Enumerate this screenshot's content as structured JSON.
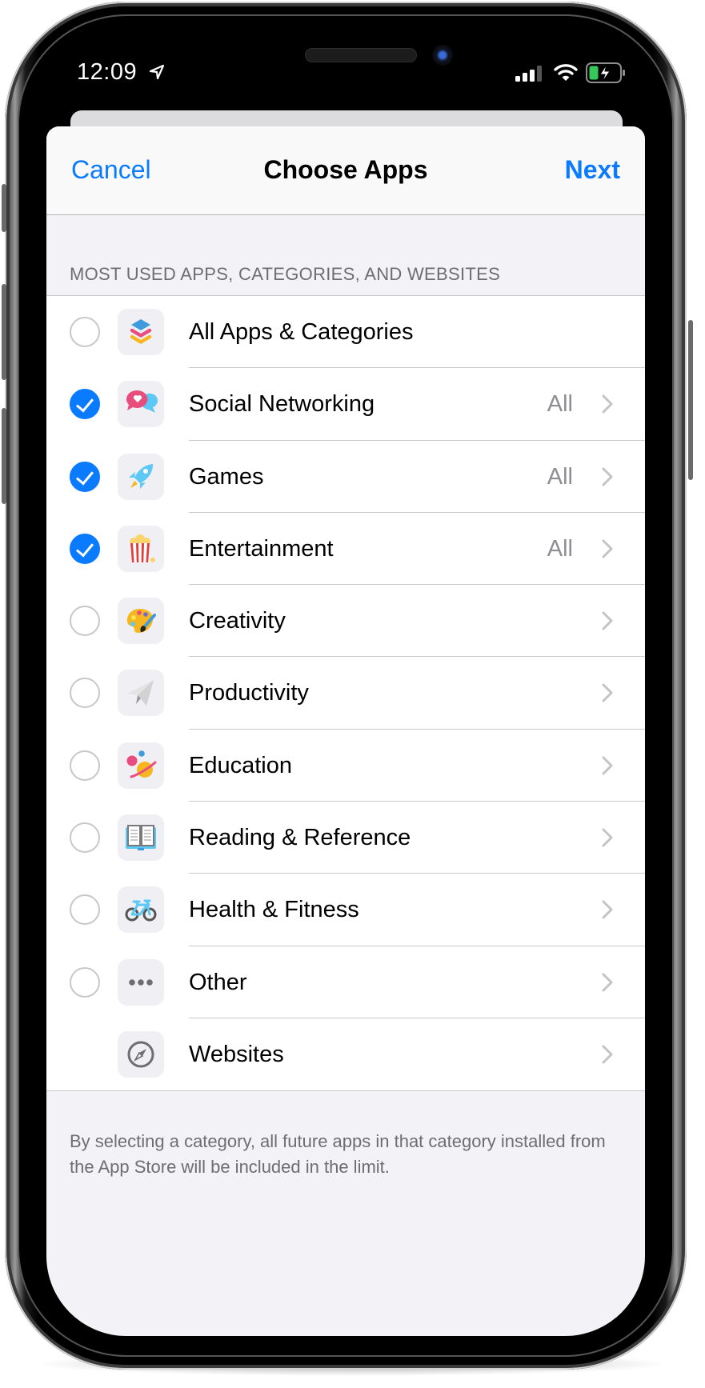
{
  "status_bar": {
    "time": "12:09",
    "icons": [
      "location-arrow-icon",
      "cellular-signal-icon",
      "wifi-icon",
      "battery-charging-icon"
    ]
  },
  "navbar": {
    "cancel_label": "Cancel",
    "title": "Choose Apps",
    "next_label": "Next"
  },
  "section_header": "MOST USED APPS, CATEGORIES, AND WEBSITES",
  "items": [
    {
      "label": "All Apps & Categories",
      "icon": "stack-layers-icon",
      "checked": false,
      "has_radio": true,
      "detail": "",
      "chevron": false
    },
    {
      "label": "Social Networking",
      "icon": "chat-bubbles-heart-icon",
      "checked": true,
      "has_radio": true,
      "detail": "All",
      "chevron": true
    },
    {
      "label": "Games",
      "icon": "rocket-icon",
      "checked": true,
      "has_radio": true,
      "detail": "All",
      "chevron": true
    },
    {
      "label": "Entertainment",
      "icon": "popcorn-icon",
      "checked": true,
      "has_radio": true,
      "detail": "All",
      "chevron": true
    },
    {
      "label": "Creativity",
      "icon": "paint-palette-icon",
      "checked": false,
      "has_radio": true,
      "detail": "",
      "chevron": true
    },
    {
      "label": "Productivity",
      "icon": "paper-plane-icon",
      "checked": false,
      "has_radio": true,
      "detail": "",
      "chevron": true
    },
    {
      "label": "Education",
      "icon": "planet-icon",
      "checked": false,
      "has_radio": true,
      "detail": "",
      "chevron": true
    },
    {
      "label": "Reading & Reference",
      "icon": "open-book-icon",
      "checked": false,
      "has_radio": true,
      "detail": "",
      "chevron": true
    },
    {
      "label": "Health & Fitness",
      "icon": "bicycle-icon",
      "checked": false,
      "has_radio": true,
      "detail": "",
      "chevron": true
    },
    {
      "label": "Other",
      "icon": "ellipsis-icon",
      "checked": false,
      "has_radio": true,
      "detail": "",
      "chevron": true
    },
    {
      "label": "Websites",
      "icon": "compass-icon",
      "checked": false,
      "has_radio": false,
      "detail": "",
      "chevron": true
    }
  ],
  "footer_note": "By selecting a category, all future apps in that category installed from the App Store will be included in the limit.",
  "colors": {
    "accent": "#0a7aff",
    "background": "#f2f2f7",
    "secondary_text": "#8e8e93",
    "section_text": "#6d6d72"
  }
}
